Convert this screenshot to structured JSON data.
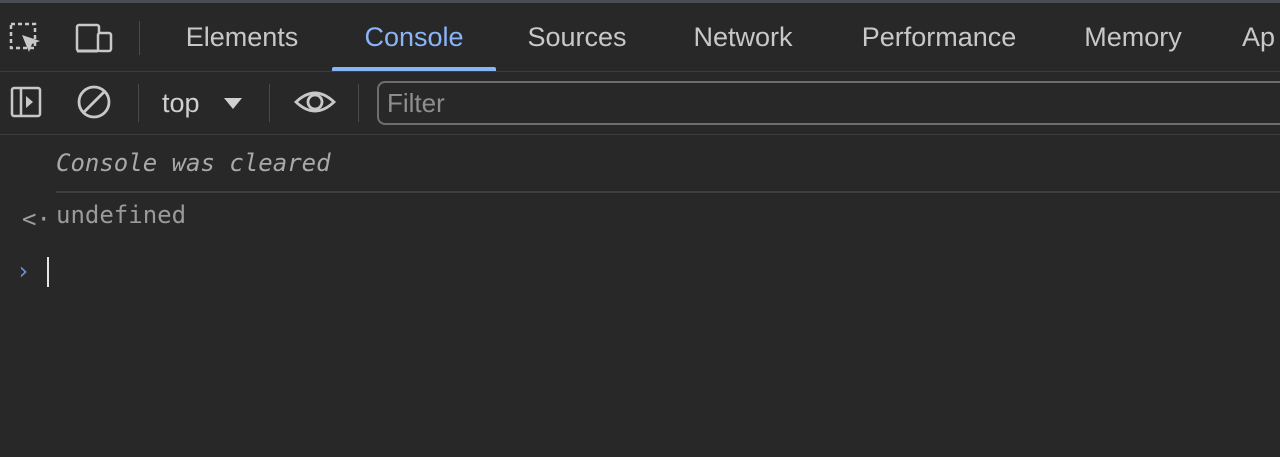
{
  "tabs": {
    "items": [
      {
        "label": "Elements"
      },
      {
        "label": "Console"
      },
      {
        "label": "Sources"
      },
      {
        "label": "Network"
      },
      {
        "label": "Performance"
      },
      {
        "label": "Memory"
      },
      {
        "label": "Ap"
      }
    ],
    "active": "Console",
    "accent_color": "#8ab4f8"
  },
  "toolbar": {
    "context_label": "top",
    "filter_placeholder": "Filter"
  },
  "icons": {
    "inspect": "inspect-element-icon",
    "device": "device-toolbar-icon",
    "sidebar": "sidebar-toggle-icon",
    "clear": "clear-console-icon",
    "live_expression": "eye-icon"
  },
  "console": {
    "cleared_message": "Console was cleared",
    "return_arrow": "<·",
    "return_value": "undefined",
    "prompt_symbol": "›"
  }
}
